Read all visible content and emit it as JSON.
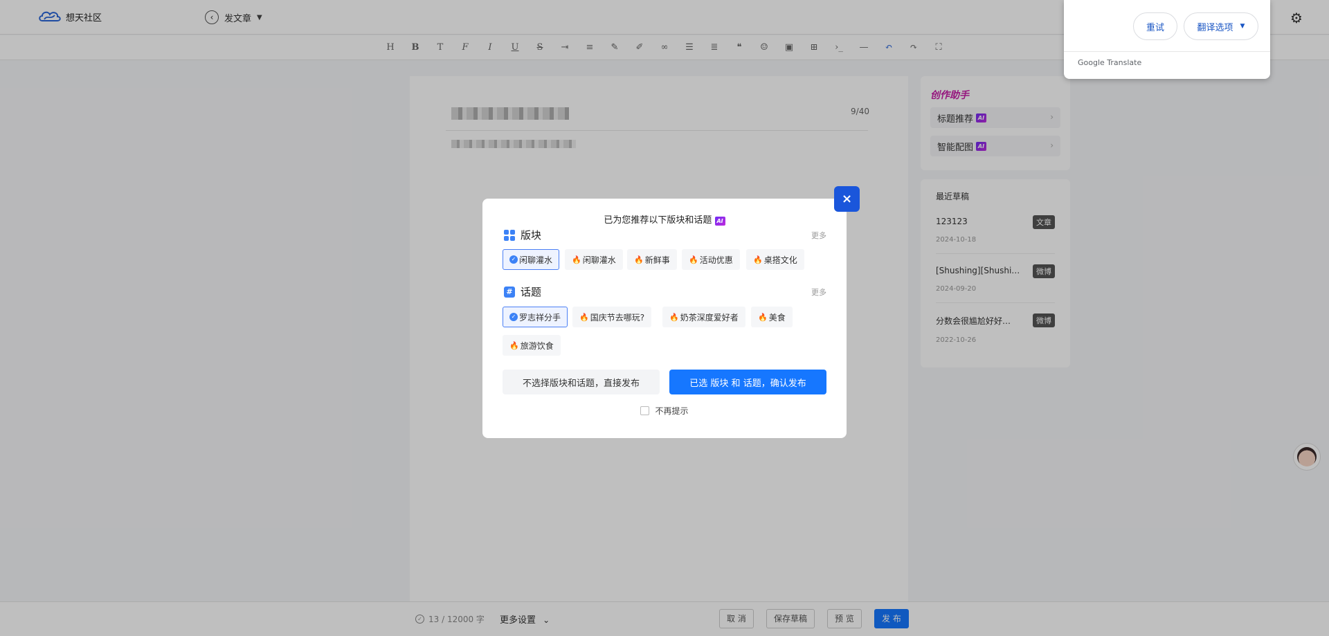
{
  "app": {
    "name": "想天社区",
    "page_title": "发文章"
  },
  "editor": {
    "title_counter": "9/40"
  },
  "assistant": {
    "title": "创作助手",
    "items": [
      {
        "label": "标题推荐",
        "badge": "AI"
      },
      {
        "label": "智能配图",
        "badge": "AI"
      }
    ]
  },
  "drafts": {
    "title": "最近草稿",
    "items": [
      {
        "name": "123123",
        "date": "2024-10-18",
        "tag": "文章"
      },
      {
        "name": "[Shushing][Shushi…",
        "date": "2024-09-20",
        "tag": "微博"
      },
      {
        "name": "分数会很尴尬好好…",
        "date": "2022-10-26",
        "tag": "微博"
      }
    ]
  },
  "bottom": {
    "word_count": "13 / 12000 字",
    "more_settings": "更多设置",
    "cancel": "取 消",
    "save_draft": "保存草稿",
    "preview": "预 览",
    "publish": "发 布"
  },
  "translate": {
    "retry": "重试",
    "options": "翻译选项",
    "footer_brand": "Google",
    "footer_product": "Translate"
  },
  "modal": {
    "title": "已为您推荐以下版块和话题",
    "title_badge": "AI",
    "section_board": "版块",
    "section_topic": "话题",
    "more": "更多",
    "boards": [
      {
        "label": "闲聊灌水",
        "selected": true
      },
      {
        "label": "闲聊灌水",
        "selected": false
      },
      {
        "label": "新鲜事",
        "selected": false
      },
      {
        "label": "活动优惠",
        "selected": false
      },
      {
        "label": "桌搭文化",
        "selected": false
      }
    ],
    "topics": [
      {
        "label": "罗志祥分手",
        "selected": true
      },
      {
        "label": "国庆节去哪玩?",
        "selected": false
      },
      {
        "label": "奶茶深度爱好者",
        "selected": false
      },
      {
        "label": "美食",
        "selected": false
      },
      {
        "label": "旅游饮食",
        "selected": false
      }
    ],
    "skip_button": "不选择版块和话题，直接发布",
    "confirm_button": "已选 版块 和 话题，确认发布",
    "no_remind": "不再提示",
    "close": "×"
  },
  "colors": {
    "accent": "#1677ff",
    "ai_badge": "#7b2cf0",
    "assistant_title": "#c81ca8"
  }
}
